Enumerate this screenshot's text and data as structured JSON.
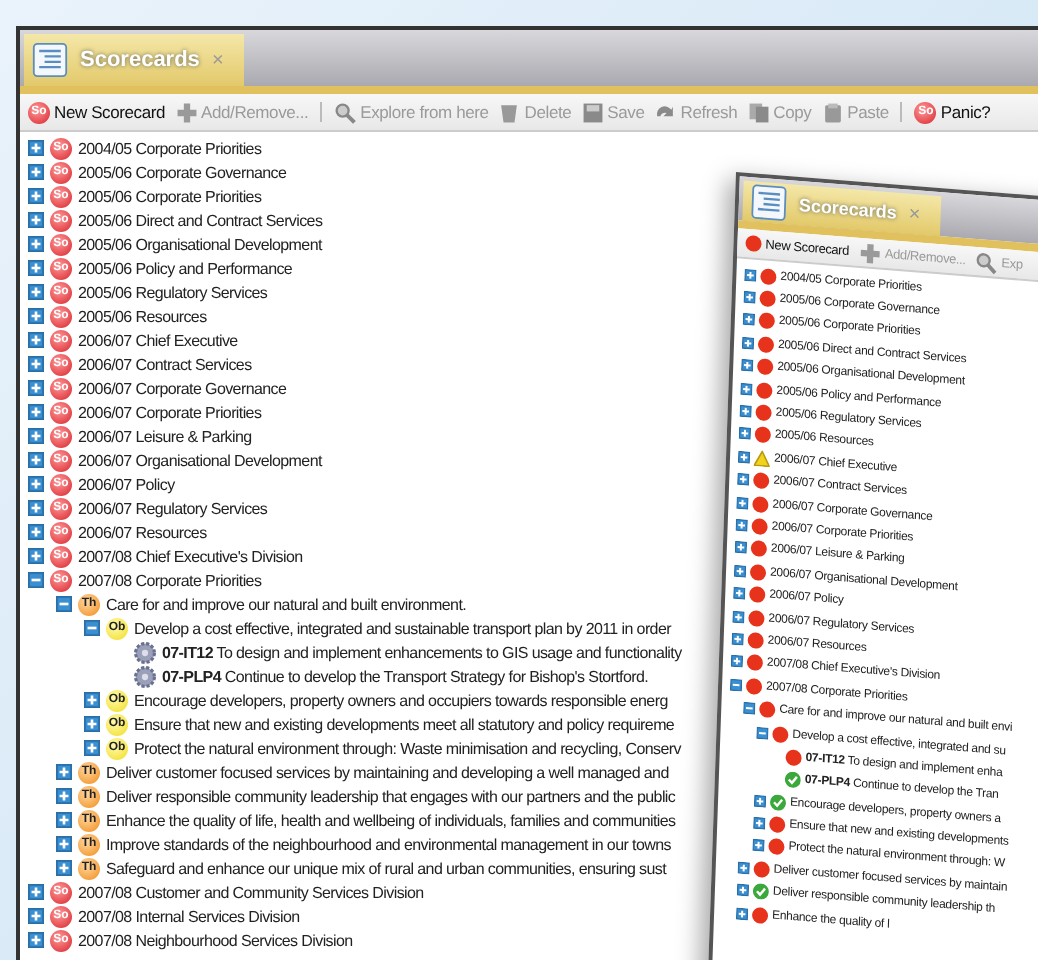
{
  "window": {
    "tab": {
      "title": "Scorecards",
      "close": "×",
      "selected": true
    },
    "toolbar": [
      {
        "kind": "new",
        "badge": "So",
        "label": "New Scorecard",
        "disabled": false
      },
      {
        "kind": "add",
        "label": "Add/Remove...",
        "disabled": true
      },
      {
        "kind": "separator"
      },
      {
        "kind": "explore",
        "label": "Explore from here",
        "disabled": true
      },
      {
        "kind": "delete",
        "label": "Delete",
        "disabled": true
      },
      {
        "kind": "save",
        "label": "Save",
        "disabled": true
      },
      {
        "kind": "refresh",
        "label": "Refresh",
        "disabled": true
      },
      {
        "kind": "copy",
        "label": "Copy",
        "disabled": true
      },
      {
        "kind": "paste",
        "label": "Paste",
        "disabled": true
      },
      {
        "kind": "separator"
      },
      {
        "kind": "panic",
        "badge": "So",
        "label": "Panic?",
        "disabled": false
      }
    ],
    "tree": [
      {
        "kind": "scorecard",
        "badge": "So",
        "label": "2004/05 Corporate Priorities",
        "expanded": false
      },
      {
        "kind": "scorecard",
        "badge": "So",
        "label": "2005/06 Corporate Governance",
        "expanded": false
      },
      {
        "kind": "scorecard",
        "badge": "So",
        "label": "2005/06 Corporate Priorities",
        "expanded": false
      },
      {
        "kind": "scorecard",
        "badge": "So",
        "label": "2005/06 Direct and Contract Services",
        "expanded": false
      },
      {
        "kind": "scorecard",
        "badge": "So",
        "label": "2005/06 Organisational Development",
        "expanded": false
      },
      {
        "kind": "scorecard",
        "badge": "So",
        "label": "2005/06 Policy and Performance",
        "expanded": false
      },
      {
        "kind": "scorecard",
        "badge": "So",
        "label": "2005/06 Regulatory Services",
        "expanded": false
      },
      {
        "kind": "scorecard",
        "badge": "So",
        "label": "2005/06 Resources",
        "expanded": false
      },
      {
        "kind": "scorecard",
        "badge": "So",
        "label": "2006/07 Chief Executive",
        "expanded": false
      },
      {
        "kind": "scorecard",
        "badge": "So",
        "label": "2006/07 Contract Services",
        "expanded": false
      },
      {
        "kind": "scorecard",
        "badge": "So",
        "label": "2006/07 Corporate Governance",
        "expanded": false
      },
      {
        "kind": "scorecard",
        "badge": "So",
        "label": "2006/07 Corporate Priorities",
        "expanded": false
      },
      {
        "kind": "scorecard",
        "badge": "So",
        "label": "2006/07 Leisure & Parking",
        "expanded": false
      },
      {
        "kind": "scorecard",
        "badge": "So",
        "label": "2006/07 Organisational Development",
        "expanded": false
      },
      {
        "kind": "scorecard",
        "badge": "So",
        "label": "2006/07 Policy",
        "expanded": false
      },
      {
        "kind": "scorecard",
        "badge": "So",
        "label": "2006/07 Regulatory Services",
        "expanded": false
      },
      {
        "kind": "scorecard",
        "badge": "So",
        "label": "2006/07 Resources",
        "expanded": false
      },
      {
        "kind": "scorecard",
        "badge": "So",
        "label": "2007/08 Chief Executive's Division",
        "expanded": false
      },
      {
        "kind": "scorecard",
        "badge": "So",
        "label": "2007/08 Corporate Priorities",
        "expanded": true,
        "children": [
          {
            "kind": "theme",
            "badge": "Th",
            "label": "Care for and improve our natural and built environment.",
            "expanded": true,
            "children": [
              {
                "kind": "objective",
                "badge": "Ob",
                "label": "Develop a cost effective, integrated and sustainable transport plan by 2011 in order",
                "expanded": true,
                "children": [
                  {
                    "kind": "measure",
                    "code": "07-IT12",
                    "label": "To design and implement enhancements to GIS usage and functionality"
                  },
                  {
                    "kind": "measure",
                    "code": "07-PLP4",
                    "label": "Continue to develop the Transport Strategy for Bishop's Stortford."
                  }
                ]
              },
              {
                "kind": "objective",
                "badge": "Ob",
                "label": "Encourage developers, property owners and occupiers towards responsible energ",
                "expanded": false
              },
              {
                "kind": "objective",
                "badge": "Ob",
                "label": "Ensure that new and existing developments meet all statutory and policy requireme",
                "expanded": false
              },
              {
                "kind": "objective",
                "badge": "Ob",
                "label": "Protect the natural environment through: Waste minimisation and recycling, Conserv",
                "expanded": false
              }
            ]
          },
          {
            "kind": "theme",
            "badge": "Th",
            "label": "Deliver customer focused services by maintaining and developing a well managed and",
            "expanded": false
          },
          {
            "kind": "theme",
            "badge": "Th",
            "label": "Deliver responsible community leadership that engages with our partners and the public",
            "expanded": false
          },
          {
            "kind": "theme",
            "badge": "Th",
            "label": "Enhance the quality of life, health and wellbeing of individuals, families and communities",
            "expanded": false
          },
          {
            "kind": "theme",
            "badge": "Th",
            "label": "Improve standards of the neighbourhood and environmental management in our towns",
            "expanded": false
          },
          {
            "kind": "theme",
            "badge": "Th",
            "label": "Safeguard and enhance our unique mix of rural and urban communities, ensuring sust",
            "expanded": false
          }
        ]
      },
      {
        "kind": "scorecard",
        "badge": "So",
        "label": "2007/08 Customer and Community Services Division",
        "expanded": false
      },
      {
        "kind": "scorecard",
        "badge": "So",
        "label": "2007/08 Internal Services Division",
        "expanded": false
      },
      {
        "kind": "scorecard",
        "badge": "So",
        "label": "2007/08 Neighbourhood Services Division",
        "expanded": false
      }
    ]
  },
  "inset_window": {
    "tab": {
      "title": "Scorecards",
      "close": "×",
      "selected": true
    },
    "toolbar": [
      {
        "kind": "new",
        "label": "New Scorecard",
        "disabled": false
      },
      {
        "kind": "add",
        "label": "Add/Remove...",
        "disabled": true
      },
      {
        "kind": "explore",
        "label": "Exp",
        "disabled": true
      }
    ],
    "tree": [
      {
        "kind": "alert",
        "label": "2004/05 Corporate Priorities",
        "expanded": false
      },
      {
        "kind": "alert",
        "label": "2005/06 Corporate Governance",
        "expanded": false
      },
      {
        "kind": "alert",
        "label": "2005/06 Corporate Priorities",
        "expanded": false
      },
      {
        "kind": "alert",
        "label": "2005/06 Direct and Contract Services",
        "expanded": false
      },
      {
        "kind": "alert",
        "label": "2005/06 Organisational Development",
        "expanded": false
      },
      {
        "kind": "alert",
        "label": "2005/06 Policy and Performance",
        "expanded": false
      },
      {
        "kind": "alert",
        "label": "2005/06 Regulatory Services",
        "expanded": false
      },
      {
        "kind": "alert",
        "label": "2005/06 Resources",
        "expanded": false
      },
      {
        "kind": "warning",
        "label": "2006/07 Chief Executive",
        "expanded": false
      },
      {
        "kind": "alert",
        "label": "2006/07 Contract Services",
        "expanded": false
      },
      {
        "kind": "alert",
        "label": "2006/07 Corporate Governance",
        "expanded": false
      },
      {
        "kind": "alert",
        "label": "2006/07 Corporate Priorities",
        "expanded": false
      },
      {
        "kind": "alert",
        "label": "2006/07 Leisure & Parking",
        "expanded": false
      },
      {
        "kind": "alert",
        "label": "2006/07 Organisational Development",
        "expanded": false
      },
      {
        "kind": "alert",
        "label": "2006/07 Policy",
        "expanded": false
      },
      {
        "kind": "alert",
        "label": "2006/07 Regulatory Services",
        "expanded": false
      },
      {
        "kind": "alert",
        "label": "2006/07 Resources",
        "expanded": false
      },
      {
        "kind": "alert",
        "label": "2007/08 Chief Executive's Division",
        "expanded": false
      },
      {
        "kind": "alert",
        "label": "2007/08 Corporate Priorities",
        "expanded": true,
        "children": [
          {
            "kind": "alert",
            "label": "Care for and improve our natural and built envi",
            "expanded": true,
            "children": [
              {
                "kind": "alert",
                "label": "Develop a cost effective, integrated and su",
                "expanded": true,
                "children": [
                  {
                    "kind": "alert",
                    "code": "07-IT12",
                    "label": "To design and implement enha"
                  },
                  {
                    "kind": "done",
                    "code": "07-PLP4",
                    "label": "Continue to develop the Tran"
                  }
                ]
              },
              {
                "kind": "done",
                "label": "Encourage developers, property owners a",
                "expanded": false
              },
              {
                "kind": "alert",
                "label": "Ensure that new and existing developments",
                "expanded": false
              },
              {
                "kind": "alert",
                "label": "Protect the natural environment through: W",
                "expanded": false
              }
            ]
          },
          {
            "kind": "alert",
            "label": "Deliver customer focused services by maintain",
            "expanded": false
          },
          {
            "kind": "done",
            "label": "Deliver responsible community leadership th",
            "expanded": false
          },
          {
            "kind": "alert",
            "label": "Enhance the quality of l",
            "expanded": false
          }
        ]
      }
    ]
  }
}
